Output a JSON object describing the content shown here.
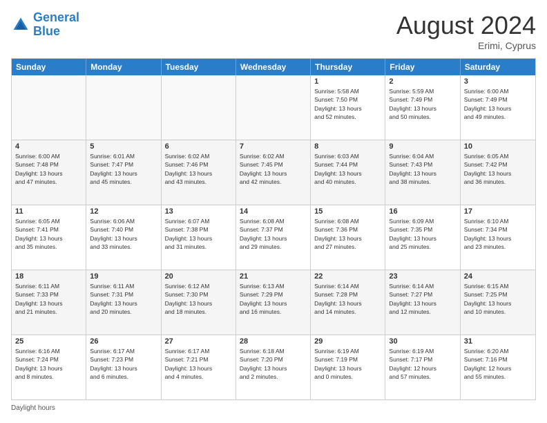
{
  "header": {
    "logo_general": "General",
    "logo_blue": "Blue",
    "month_title": "August 2024",
    "location": "Erimi, Cyprus"
  },
  "days_of_week": [
    "Sunday",
    "Monday",
    "Tuesday",
    "Wednesday",
    "Thursday",
    "Friday",
    "Saturday"
  ],
  "weeks": [
    [
      {
        "day": "",
        "info": ""
      },
      {
        "day": "",
        "info": ""
      },
      {
        "day": "",
        "info": ""
      },
      {
        "day": "",
        "info": ""
      },
      {
        "day": "1",
        "info": "Sunrise: 5:58 AM\nSunset: 7:50 PM\nDaylight: 13 hours\nand 52 minutes."
      },
      {
        "day": "2",
        "info": "Sunrise: 5:59 AM\nSunset: 7:49 PM\nDaylight: 13 hours\nand 50 minutes."
      },
      {
        "day": "3",
        "info": "Sunrise: 6:00 AM\nSunset: 7:49 PM\nDaylight: 13 hours\nand 49 minutes."
      }
    ],
    [
      {
        "day": "4",
        "info": "Sunrise: 6:00 AM\nSunset: 7:48 PM\nDaylight: 13 hours\nand 47 minutes."
      },
      {
        "day": "5",
        "info": "Sunrise: 6:01 AM\nSunset: 7:47 PM\nDaylight: 13 hours\nand 45 minutes."
      },
      {
        "day": "6",
        "info": "Sunrise: 6:02 AM\nSunset: 7:46 PM\nDaylight: 13 hours\nand 43 minutes."
      },
      {
        "day": "7",
        "info": "Sunrise: 6:02 AM\nSunset: 7:45 PM\nDaylight: 13 hours\nand 42 minutes."
      },
      {
        "day": "8",
        "info": "Sunrise: 6:03 AM\nSunset: 7:44 PM\nDaylight: 13 hours\nand 40 minutes."
      },
      {
        "day": "9",
        "info": "Sunrise: 6:04 AM\nSunset: 7:43 PM\nDaylight: 13 hours\nand 38 minutes."
      },
      {
        "day": "10",
        "info": "Sunrise: 6:05 AM\nSunset: 7:42 PM\nDaylight: 13 hours\nand 36 minutes."
      }
    ],
    [
      {
        "day": "11",
        "info": "Sunrise: 6:05 AM\nSunset: 7:41 PM\nDaylight: 13 hours\nand 35 minutes."
      },
      {
        "day": "12",
        "info": "Sunrise: 6:06 AM\nSunset: 7:40 PM\nDaylight: 13 hours\nand 33 minutes."
      },
      {
        "day": "13",
        "info": "Sunrise: 6:07 AM\nSunset: 7:38 PM\nDaylight: 13 hours\nand 31 minutes."
      },
      {
        "day": "14",
        "info": "Sunrise: 6:08 AM\nSunset: 7:37 PM\nDaylight: 13 hours\nand 29 minutes."
      },
      {
        "day": "15",
        "info": "Sunrise: 6:08 AM\nSunset: 7:36 PM\nDaylight: 13 hours\nand 27 minutes."
      },
      {
        "day": "16",
        "info": "Sunrise: 6:09 AM\nSunset: 7:35 PM\nDaylight: 13 hours\nand 25 minutes."
      },
      {
        "day": "17",
        "info": "Sunrise: 6:10 AM\nSunset: 7:34 PM\nDaylight: 13 hours\nand 23 minutes."
      }
    ],
    [
      {
        "day": "18",
        "info": "Sunrise: 6:11 AM\nSunset: 7:33 PM\nDaylight: 13 hours\nand 21 minutes."
      },
      {
        "day": "19",
        "info": "Sunrise: 6:11 AM\nSunset: 7:31 PM\nDaylight: 13 hours\nand 20 minutes."
      },
      {
        "day": "20",
        "info": "Sunrise: 6:12 AM\nSunset: 7:30 PM\nDaylight: 13 hours\nand 18 minutes."
      },
      {
        "day": "21",
        "info": "Sunrise: 6:13 AM\nSunset: 7:29 PM\nDaylight: 13 hours\nand 16 minutes."
      },
      {
        "day": "22",
        "info": "Sunrise: 6:14 AM\nSunset: 7:28 PM\nDaylight: 13 hours\nand 14 minutes."
      },
      {
        "day": "23",
        "info": "Sunrise: 6:14 AM\nSunset: 7:27 PM\nDaylight: 13 hours\nand 12 minutes."
      },
      {
        "day": "24",
        "info": "Sunrise: 6:15 AM\nSunset: 7:25 PM\nDaylight: 13 hours\nand 10 minutes."
      }
    ],
    [
      {
        "day": "25",
        "info": "Sunrise: 6:16 AM\nSunset: 7:24 PM\nDaylight: 13 hours\nand 8 minutes."
      },
      {
        "day": "26",
        "info": "Sunrise: 6:17 AM\nSunset: 7:23 PM\nDaylight: 13 hours\nand 6 minutes."
      },
      {
        "day": "27",
        "info": "Sunrise: 6:17 AM\nSunset: 7:21 PM\nDaylight: 13 hours\nand 4 minutes."
      },
      {
        "day": "28",
        "info": "Sunrise: 6:18 AM\nSunset: 7:20 PM\nDaylight: 13 hours\nand 2 minutes."
      },
      {
        "day": "29",
        "info": "Sunrise: 6:19 AM\nSunset: 7:19 PM\nDaylight: 13 hours\nand 0 minutes."
      },
      {
        "day": "30",
        "info": "Sunrise: 6:19 AM\nSunset: 7:17 PM\nDaylight: 12 hours\nand 57 minutes."
      },
      {
        "day": "31",
        "info": "Sunrise: 6:20 AM\nSunset: 7:16 PM\nDaylight: 12 hours\nand 55 minutes."
      }
    ]
  ],
  "footer": {
    "note": "Daylight hours"
  }
}
